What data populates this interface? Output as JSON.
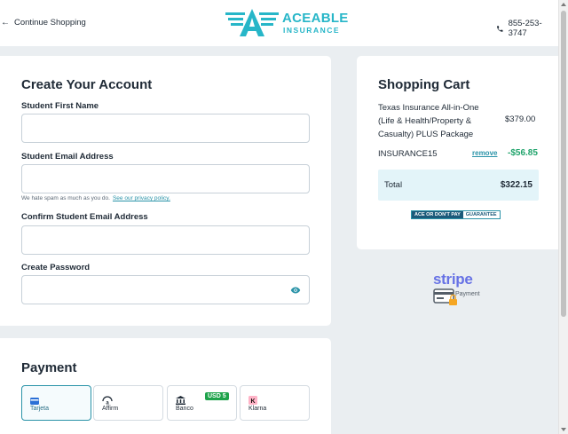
{
  "header": {
    "back_label": "Continue Shopping",
    "logo_line1": "ACEABLE",
    "logo_line2": "INSURANCE",
    "phone": "855-253-3747"
  },
  "account": {
    "title": "Create Your Account",
    "first_name_label": "Student First Name",
    "first_name_value": "",
    "email_label": "Student Email Address",
    "email_value": "",
    "spam_note": "We hate spam as much as you do.",
    "privacy_link": "See our privacy policy.",
    "confirm_email_label": "Confirm Student Email Address",
    "confirm_email_value": "",
    "password_label": "Create Password",
    "password_value": ""
  },
  "payment": {
    "title": "Payment",
    "methods": [
      {
        "label": "Tarjeta",
        "icon": "card-icon",
        "selected": true
      },
      {
        "label": "Affirm",
        "icon": "affirm-icon",
        "selected": false
      },
      {
        "label": "Banco",
        "icon": "bank-icon",
        "selected": false,
        "badge": "USD 5"
      },
      {
        "label": "Klarna",
        "icon": "klarna-icon",
        "selected": false
      }
    ]
  },
  "cart": {
    "title": "Shopping Cart",
    "item_name": "Texas Insurance All-in-One (Life & Health/Property & Casualty) PLUS Package",
    "item_price": "$379.00",
    "coupon_code": "INSURANCE15",
    "coupon_remove": "remove",
    "coupon_amount": "-$56.85",
    "total_label": "Total",
    "total_value": "$322.15",
    "guarantee_part1": "ACE OR DON'T PAY",
    "guarantee_part2": "GUARANTEE"
  },
  "badge": {
    "brand": "stripe",
    "label": "Payment"
  },
  "colors": {
    "accent": "#27b6c8",
    "link": "#2a93a8",
    "discount": "#1fa36b",
    "stripe": "#6772e5",
    "background": "#eaeef1"
  }
}
